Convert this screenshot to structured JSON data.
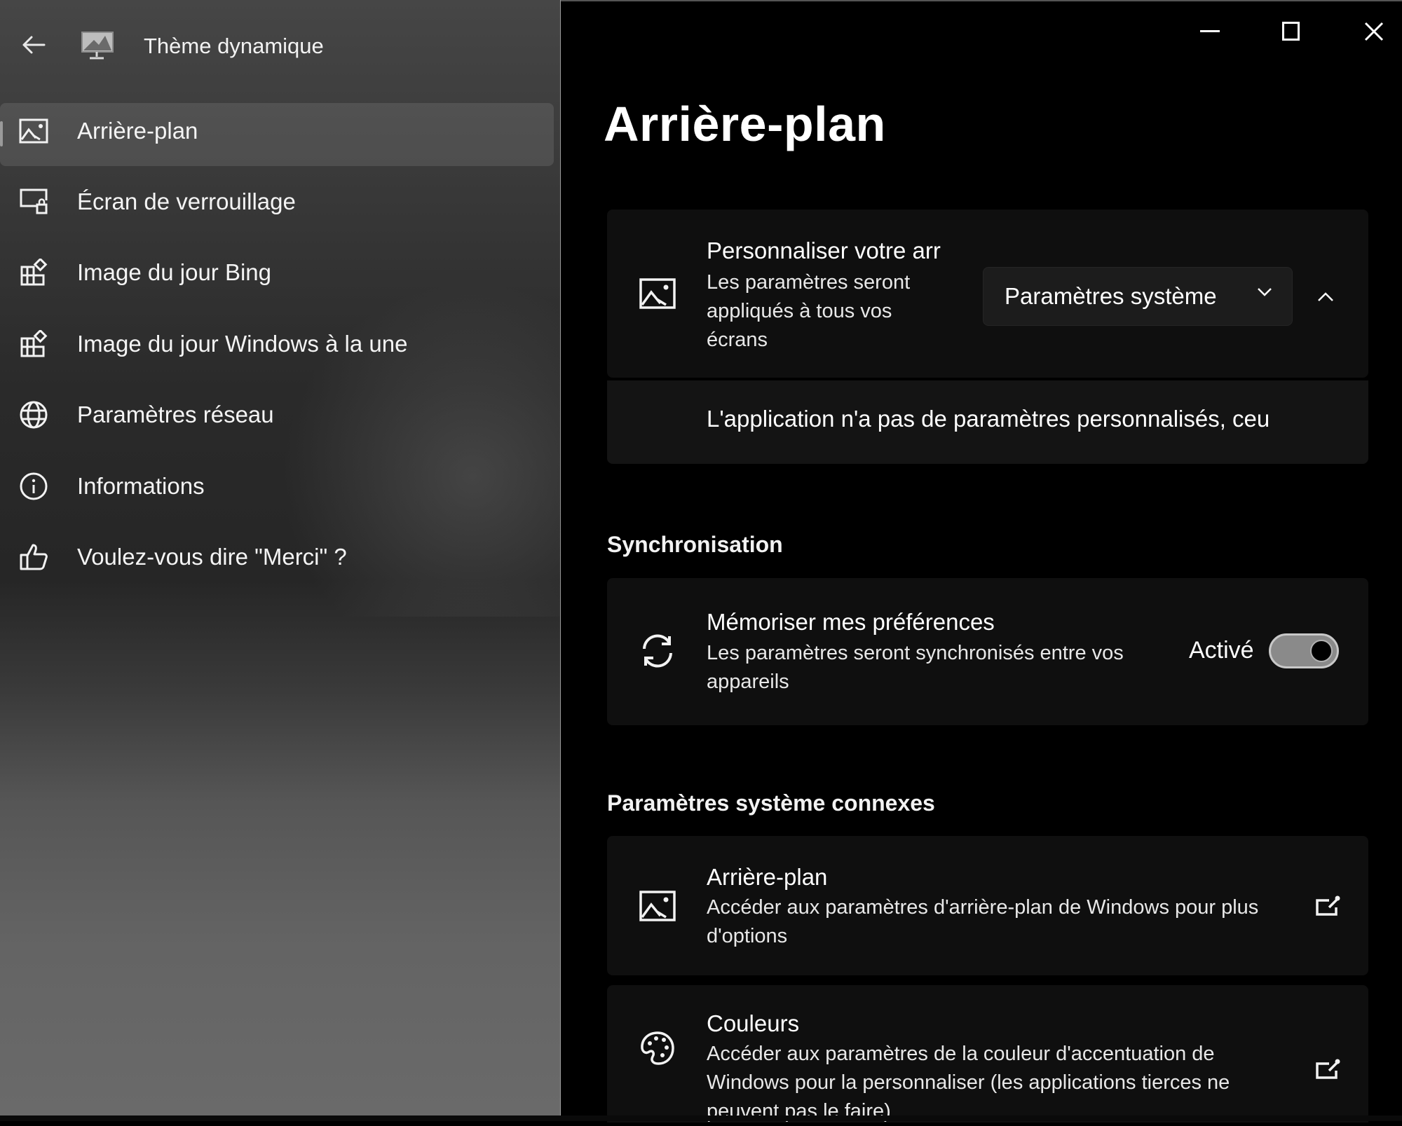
{
  "app": {
    "title": "Thème dynamique",
    "back_icon": "arrow-left-icon",
    "app_icon": "monitor-theme-icon"
  },
  "window_controls": {
    "minimize": "minimize-icon",
    "maximize": "maximize-icon",
    "close": "close-icon"
  },
  "sidebar": {
    "items": [
      {
        "label": "Arrière-plan",
        "icon": "image-icon",
        "selected": true
      },
      {
        "label": "Écran de verrouillage",
        "icon": "lock-screen-icon",
        "selected": false
      },
      {
        "label": "Image du jour Bing",
        "icon": "apps-add-icon",
        "selected": false
      },
      {
        "label": "Image du jour Windows à la une",
        "icon": "apps-add-icon",
        "selected": false
      },
      {
        "label": "Paramètres réseau",
        "icon": "globe-icon",
        "selected": false
      },
      {
        "label": "Informations",
        "icon": "info-icon",
        "selected": false
      },
      {
        "label": "Voulez-vous dire \"Merci\" ?",
        "icon": "thumbs-up-icon",
        "selected": false
      }
    ]
  },
  "main": {
    "page_title": "Arrière-plan",
    "personalize_card": {
      "title": "Personnaliser votre arr",
      "description": "Les paramètres seront appliqués à tous vos écrans",
      "dropdown_value": "Paramètres système",
      "expanded_text": "L'application n'a pas de paramètres personnalisés, ceu"
    },
    "sync_section": {
      "title": "Synchronisation",
      "card": {
        "title": "Mémoriser mes préférences",
        "description": "Les paramètres seront synchronisés entre vos appareils",
        "state_label": "Activé",
        "toggle_on": true
      }
    },
    "related_section": {
      "title": "Paramètres système connexes",
      "items": [
        {
          "title": "Arrière-plan",
          "description": "Accéder aux paramètres d'arrière-plan de Windows pour plus d'options",
          "icon": "image-icon"
        },
        {
          "title": "Couleurs",
          "description": "Accéder aux paramètres de la couleur d'accentuation de Windows pour la personnaliser (les applications tierces ne peuvent pas le faire)",
          "icon": "palette-icon"
        }
      ]
    }
  }
}
